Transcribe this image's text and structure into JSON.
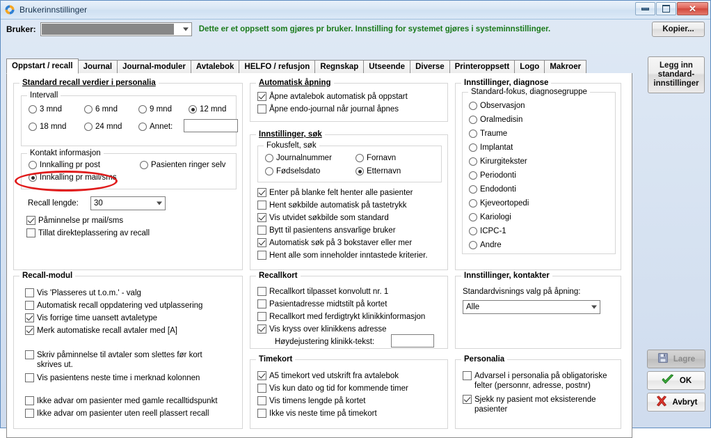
{
  "window": {
    "title": "Brukerinnstillinger",
    "icon": "app-icon",
    "minimize_label": "–",
    "maximize_label": "□",
    "close_label": "✕"
  },
  "header": {
    "bruker_label": "Bruker:",
    "bruker_value": "",
    "note": "Dette er et oppsett som gjøres pr bruker. Innstilling for systemet gjøres i systeminnstillinger.",
    "note_color": "#1b7a1b"
  },
  "tabs": [
    {
      "label": "Oppstart / recall",
      "active": true
    },
    {
      "label": "Journal",
      "active": false
    },
    {
      "label": "Journal-moduler",
      "active": false
    },
    {
      "label": "Avtalebok",
      "active": false
    },
    {
      "label": "HELFO / refusjon",
      "active": false
    },
    {
      "label": "Regnskap",
      "active": false
    },
    {
      "label": "Utseende",
      "active": false
    },
    {
      "label": "Diverse",
      "active": false
    },
    {
      "label": "Printeroppsett",
      "active": false
    },
    {
      "label": "Logo",
      "active": false
    },
    {
      "label": "Makroer",
      "active": false
    }
  ],
  "side_buttons": {
    "kopier": "Kopier...",
    "legg_inn_standard": "Legg inn standard-innstillinger"
  },
  "action_buttons": {
    "lagre": "Lagre",
    "lagre_disabled": true,
    "ok": "OK",
    "avbryt": "Avbryt"
  },
  "standard_recall": {
    "title": "Standard recall verdier i personalia",
    "intervall": {
      "title": "Intervall",
      "options": [
        {
          "label": "3 mnd",
          "checked": false
        },
        {
          "label": "6 mnd",
          "checked": false
        },
        {
          "label": "9 mnd",
          "checked": false
        },
        {
          "label": "12 mnd",
          "checked": true
        },
        {
          "label": "18 mnd",
          "checked": false
        },
        {
          "label": "24 mnd",
          "checked": false
        },
        {
          "label": "Annet:",
          "checked": false
        }
      ],
      "annet_value": ""
    },
    "kontakt": {
      "title": "Kontakt informasjon",
      "options": [
        {
          "label": "Innkalling pr post",
          "checked": false
        },
        {
          "label": "Pasienten ringer selv",
          "checked": false
        },
        {
          "label": "Innkalling pr mail/sms",
          "checked": true
        }
      ]
    },
    "recall_lengde_label": "Recall lengde:",
    "recall_lengde_value": "30",
    "checkboxes": [
      {
        "label": "Påminnelse pr mail/sms",
        "checked": true
      },
      {
        "label": "Tillat direkteplassering av recall",
        "checked": false
      }
    ]
  },
  "recall_modul": {
    "title": "Recall-modul",
    "group1": [
      {
        "label": "Vis 'Plasseres ut t.o.m.' - valg",
        "checked": false
      },
      {
        "label": "Automatisk recall oppdatering ved utplassering",
        "checked": false
      },
      {
        "label": "Vis forrige time uansett avtaletype",
        "checked": true
      },
      {
        "label": "Merk automatiske recall avtaler med [A]",
        "checked": true
      }
    ],
    "group2": [
      {
        "label": "Skriv påminnelse til avtaler som slettes før kort skrives ut.",
        "checked": false
      },
      {
        "label": "Vis pasientens neste time i merknad kolonnen",
        "checked": false
      }
    ],
    "group3": [
      {
        "label": "Ikke advar om pasienter med gamle recalltidspunkt",
        "checked": false
      },
      {
        "label": "Ikke advar om pasienter uten reell plassert recall",
        "checked": false
      }
    ]
  },
  "automatisk_apning": {
    "title": "Automatisk åpning",
    "checkboxes": [
      {
        "label": "Åpne avtalebok automatisk på oppstart",
        "checked": true
      },
      {
        "label": "Åpne endo-journal når journal åpnes",
        "checked": false
      }
    ]
  },
  "innstillinger_sok": {
    "title": "Innstillinger, søk",
    "fokusfelt": {
      "title": "Fokusfelt, søk",
      "options": [
        {
          "label": "Journalnummer",
          "checked": false
        },
        {
          "label": "Fornavn",
          "checked": false
        },
        {
          "label": "Fødselsdato",
          "checked": false
        },
        {
          "label": "Etternavn",
          "checked": true
        }
      ]
    },
    "checkboxes": [
      {
        "label": "Enter på blanke felt henter alle pasienter",
        "checked": true
      },
      {
        "label": "Hent søkbilde automatisk på tastetrykk",
        "checked": false
      },
      {
        "label": "Vis utvidet søkbilde som standard",
        "checked": true
      },
      {
        "label": "Bytt til pasientens ansvarlige bruker",
        "checked": false
      },
      {
        "label": "Automatisk søk på 3 bokstaver eller mer",
        "checked": true
      },
      {
        "label": "Hent alle som inneholder inntastede kriterier.",
        "checked": false
      }
    ]
  },
  "recallkort": {
    "title": "Recallkort",
    "checkboxes": [
      {
        "label": "Recallkort tilpasset konvolutt nr. 1",
        "checked": false
      },
      {
        "label": "Pasientadresse midtstilt på kortet",
        "checked": false
      },
      {
        "label": "Recallkort med ferdigtrykt klinikkinformasjon",
        "checked": false
      },
      {
        "label": "Vis kryss over klinikkens adresse",
        "checked": true
      }
    ],
    "hoyde_label": "Høydejustering klinikk-tekst:",
    "hoyde_value": ""
  },
  "timekort": {
    "title": "Timekort",
    "checkboxes": [
      {
        "label": "A5 timekort ved utskrift fra avtalebok",
        "checked": true
      },
      {
        "label": "Vis kun dato og tid for kommende timer",
        "checked": false
      },
      {
        "label": "Vis timens lengde på kortet",
        "checked": false
      },
      {
        "label": "Ikke vis neste time på timekort",
        "checked": false
      }
    ]
  },
  "innstillinger_diagnose": {
    "title": "Innstillinger, diagnose",
    "subgroup_title": "Standard-fokus, diagnosegruppe",
    "options": [
      {
        "label": "Observasjon",
        "checked": false
      },
      {
        "label": "Oralmedisin",
        "checked": false
      },
      {
        "label": "Traume",
        "checked": false
      },
      {
        "label": "Implantat",
        "checked": false
      },
      {
        "label": "Kirurgitekster",
        "checked": false
      },
      {
        "label": "Periodonti",
        "checked": false
      },
      {
        "label": "Endodonti",
        "checked": false
      },
      {
        "label": "Kjeveortopedi",
        "checked": false
      },
      {
        "label": "Kariologi",
        "checked": false
      },
      {
        "label": "ICPC-1",
        "checked": false
      },
      {
        "label": "Andre",
        "checked": false
      }
    ]
  },
  "innstillinger_kontakter": {
    "title": "Innstillinger, kontakter",
    "label": "Standardvisnings valg på åpning:",
    "value": "Alle"
  },
  "personalia": {
    "title": "Personalia",
    "checkboxes": [
      {
        "label": "Advarsel i personalia på obligatoriske felter (personnr, adresse, postnr)",
        "checked": false
      },
      {
        "label": "Sjekk ny pasient mot eksisterende pasienter",
        "checked": true
      }
    ]
  },
  "annotation": {
    "highlight_color": "#e01b1b",
    "highlight_target": "Innkalling pr mail/sms"
  }
}
